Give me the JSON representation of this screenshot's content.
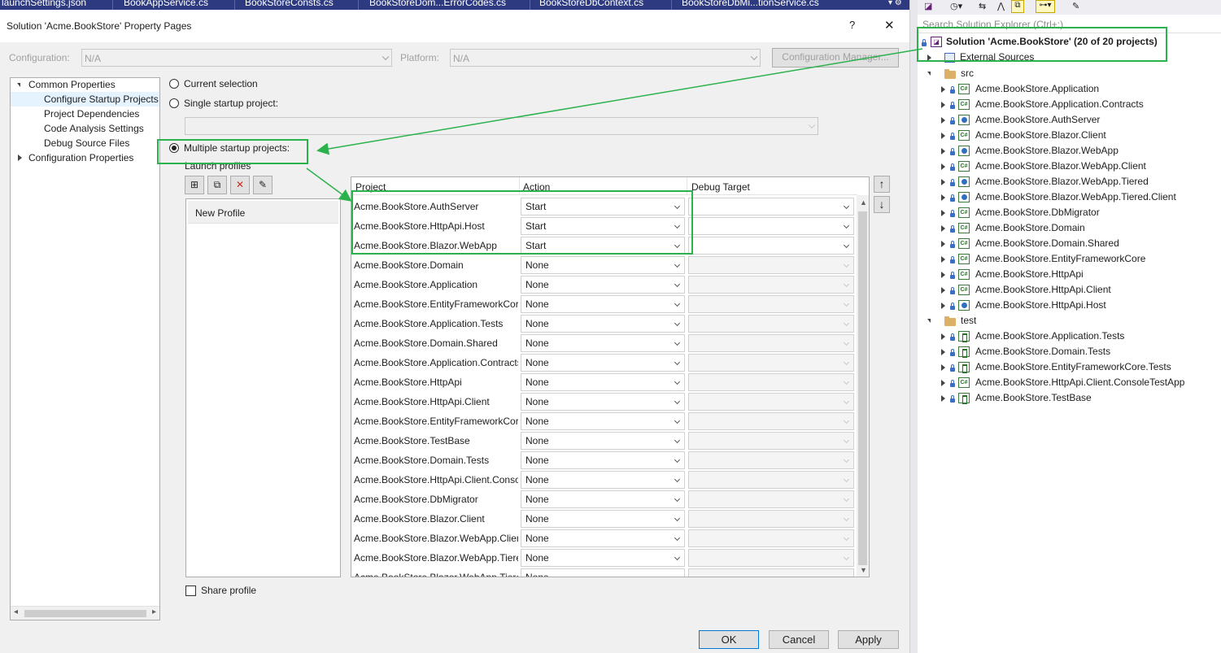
{
  "doc_tabs": [
    "launchSettings.json",
    "BookAppService.cs",
    "BookStoreConsts.cs",
    "BookStoreDom...ErrorCodes.cs",
    "BookStoreDbContext.cs",
    "BookStoreDbMi...tionService.cs"
  ],
  "dialog": {
    "title": "Solution 'Acme.BookStore' Property Pages",
    "help": "?",
    "close": "✕",
    "configuration_label": "Configuration:",
    "configuration_value": "N/A",
    "platform_label": "Platform:",
    "platform_value": "N/A",
    "config_manager_label": "Configuration Manager...",
    "tree": {
      "common": "Common Properties",
      "items": [
        "Configure Startup Projects",
        "Project Dependencies",
        "Code Analysis Settings",
        "Debug Source Files"
      ],
      "config": "Configuration Properties"
    },
    "radio_current": "Current selection",
    "radio_single": "Single startup project:",
    "radio_multiple": "Multiple startup projects:",
    "launch_profiles_label": "Launch profiles",
    "new_profile": "New Profile",
    "share_profile": "Share profile",
    "grid_headers": {
      "project": "Project",
      "action": "Action",
      "debug": "Debug Target"
    },
    "rows": [
      {
        "project": "Acme.BookStore.AuthServer",
        "action": "Start"
      },
      {
        "project": "Acme.BookStore.HttpApi.Host",
        "action": "Start"
      },
      {
        "project": "Acme.BookStore.Blazor.WebApp",
        "action": "Start"
      },
      {
        "project": "Acme.BookStore.Domain",
        "action": "None"
      },
      {
        "project": "Acme.BookStore.Application",
        "action": "None"
      },
      {
        "project": "Acme.BookStore.EntityFrameworkCore",
        "action": "None"
      },
      {
        "project": "Acme.BookStore.Application.Tests",
        "action": "None"
      },
      {
        "project": "Acme.BookStore.Domain.Shared",
        "action": "None"
      },
      {
        "project": "Acme.BookStore.Application.Contracts",
        "action": "None"
      },
      {
        "project": "Acme.BookStore.HttpApi",
        "action": "None"
      },
      {
        "project": "Acme.BookStore.HttpApi.Client",
        "action": "None"
      },
      {
        "project": "Acme.BookStore.EntityFrameworkCore",
        "action": "None"
      },
      {
        "project": "Acme.BookStore.TestBase",
        "action": "None"
      },
      {
        "project": "Acme.BookStore.Domain.Tests",
        "action": "None"
      },
      {
        "project": "Acme.BookStore.HttpApi.Client.ConsoleTestApp",
        "action": "None"
      },
      {
        "project": "Acme.BookStore.DbMigrator",
        "action": "None"
      },
      {
        "project": "Acme.BookStore.Blazor.Client",
        "action": "None"
      },
      {
        "project": "Acme.BookStore.Blazor.WebApp.Client",
        "action": "None"
      },
      {
        "project": "Acme.BookStore.Blazor.WebApp.Tiered",
        "action": "None"
      },
      {
        "project": "Acme.BookStore.Blazor.WebApp.Tiered",
        "action": "None"
      }
    ],
    "ok": "OK",
    "cancel": "Cancel",
    "apply": "Apply"
  },
  "solution_explorer": {
    "search_placeholder": "Search Solution Explorer (Ctrl+;)",
    "solution_label": "Solution 'Acme.BookStore' (20 of 20 projects)",
    "external_sources": "External Sources",
    "src_folder": "src",
    "src_projects": [
      {
        "name": "Acme.BookStore.Application",
        "icon": "csharp-project-icon"
      },
      {
        "name": "Acme.BookStore.Application.Contracts",
        "icon": "csharp-project-icon"
      },
      {
        "name": "Acme.BookStore.AuthServer",
        "icon": "web-project-icon"
      },
      {
        "name": "Acme.BookStore.Blazor.Client",
        "icon": "csharp-project-icon"
      },
      {
        "name": "Acme.BookStore.Blazor.WebApp",
        "icon": "web-project-icon"
      },
      {
        "name": "Acme.BookStore.Blazor.WebApp.Client",
        "icon": "csharp-project-icon"
      },
      {
        "name": "Acme.BookStore.Blazor.WebApp.Tiered",
        "icon": "web-project-icon"
      },
      {
        "name": "Acme.BookStore.Blazor.WebApp.Tiered.Client",
        "icon": "web-project-icon"
      },
      {
        "name": "Acme.BookStore.DbMigrator",
        "icon": "csharp-project-icon"
      },
      {
        "name": "Acme.BookStore.Domain",
        "icon": "csharp-project-icon"
      },
      {
        "name": "Acme.BookStore.Domain.Shared",
        "icon": "csharp-project-icon"
      },
      {
        "name": "Acme.BookStore.EntityFrameworkCore",
        "icon": "csharp-project-icon"
      },
      {
        "name": "Acme.BookStore.HttpApi",
        "icon": "csharp-project-icon"
      },
      {
        "name": "Acme.BookStore.HttpApi.Client",
        "icon": "csharp-project-icon"
      },
      {
        "name": "Acme.BookStore.HttpApi.Host",
        "icon": "web-project-icon"
      }
    ],
    "test_folder": "test",
    "test_projects": [
      {
        "name": "Acme.BookStore.Application.Tests",
        "icon": "test-project-icon"
      },
      {
        "name": "Acme.BookStore.Domain.Tests",
        "icon": "test-project-icon"
      },
      {
        "name": "Acme.BookStore.EntityFrameworkCore.Tests",
        "icon": "test-project-icon"
      },
      {
        "name": "Acme.BookStore.HttpApi.Client.ConsoleTestApp",
        "icon": "csharp-project-icon"
      },
      {
        "name": "Acme.BookStore.TestBase",
        "icon": "test-project-icon"
      }
    ]
  },
  "colors": {
    "annotation_green": "#2bb24c",
    "vs_tab_blue": "#2d3a80",
    "selection": "#e5f3ff"
  }
}
